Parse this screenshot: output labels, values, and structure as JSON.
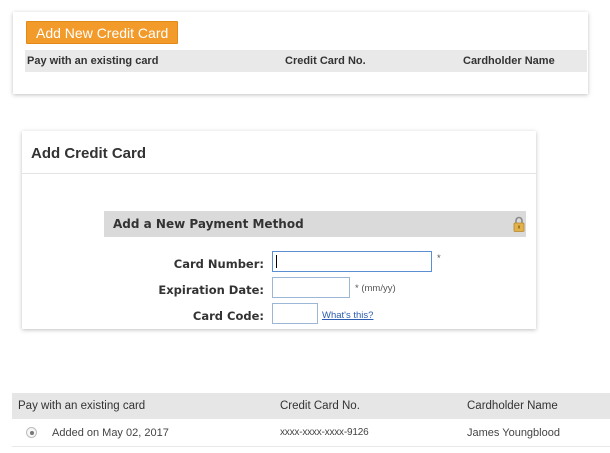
{
  "top_panel": {
    "add_button_label": "Add New Credit Card",
    "columns": [
      "Pay with an existing card",
      "Credit Card No.",
      "Cardholder Name"
    ]
  },
  "add_card": {
    "title": "Add Credit Card",
    "section_title": "Add a New Payment Method",
    "card_number_label": "Card Number:",
    "card_number_value": "",
    "required_mark": "*",
    "expiration_label": "Expiration Date:",
    "expiration_value": "",
    "expiration_hint": "* (mm/yy)",
    "card_code_label": "Card Code:",
    "card_code_value": "",
    "whats_this_link": "What's this?",
    "lock_icon": "padlock-icon"
  },
  "existing_cards": {
    "columns": [
      "Pay with an existing card",
      "Credit Card No.",
      "Cardholder Name"
    ],
    "rows": [
      {
        "added": "Added on May 02, 2017",
        "number": "xxxx-xxxx-xxxx-9126",
        "holder": "James Youngblood",
        "selected": true
      }
    ]
  }
}
